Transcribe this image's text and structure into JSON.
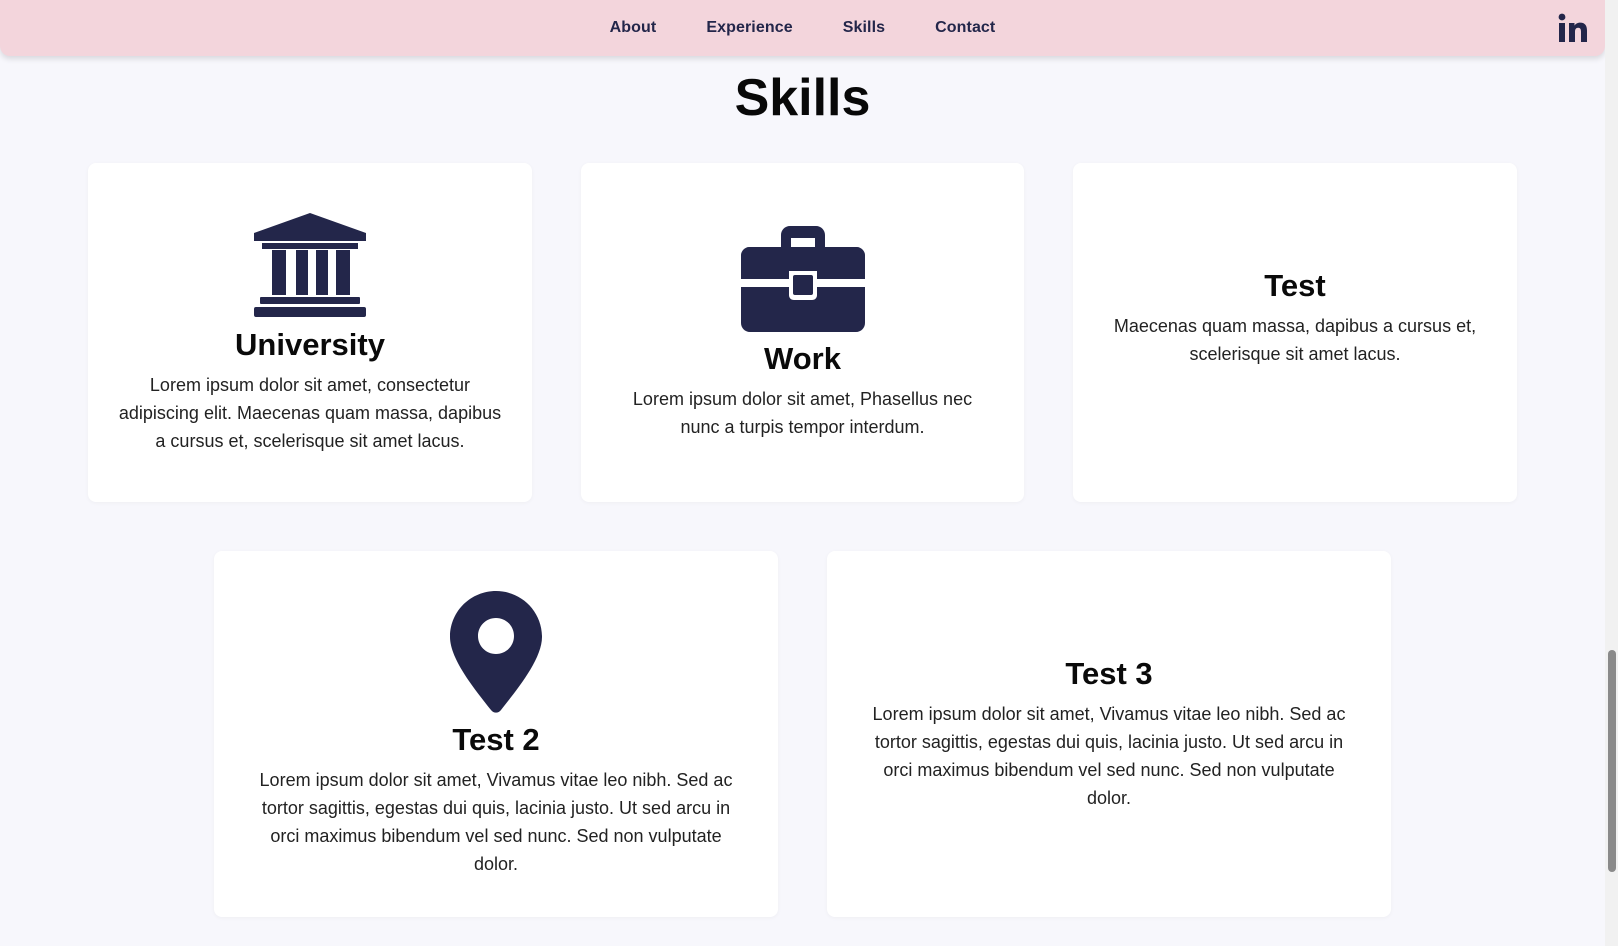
{
  "nav": {
    "links": [
      "About",
      "Experience",
      "Skills",
      "Contact"
    ],
    "social_icon": "linkedin-icon"
  },
  "section": {
    "title": "Skills"
  },
  "cards": [
    {
      "icon": "bank-icon",
      "title": "University",
      "text": "Lorem ipsum dolor sit amet, consectetur adipiscing elit. Maecenas quam massa, dapibus a cursus et, scelerisque sit amet lacus."
    },
    {
      "icon": "briefcase-icon",
      "title": "Work",
      "text": "Lorem ipsum dolor sit amet, Phasellus nec nunc a turpis tempor interdum."
    },
    {
      "icon": "",
      "title": "Test",
      "text": "Maecenas quam massa, dapibus a cursus et, scelerisque sit amet lacus."
    },
    {
      "icon": "map-pin-icon",
      "title": "Test 2",
      "text": "Lorem ipsum dolor sit amet, Vivamus vitae leo nibh. Sed ac tortor sagittis, egestas dui quis, lacinia justo. Ut sed arcu in orci maximus bibendum vel sed nunc. Sed non vulputate dolor."
    },
    {
      "icon": "",
      "title": "Test 3",
      "text": "Lorem ipsum dolor sit amet, Vivamus vitae leo nibh. Sed ac tortor sagittis, egestas dui quis, lacinia justo. Ut sed arcu in orci maximus bibendum vel sed nunc. Sed non vulputate dolor."
    }
  ],
  "colors": {
    "navbar_bg": "#f3d5dc",
    "page_bg": "#f7f7fc",
    "icon": "#23264a",
    "card_bg": "#ffffff"
  }
}
